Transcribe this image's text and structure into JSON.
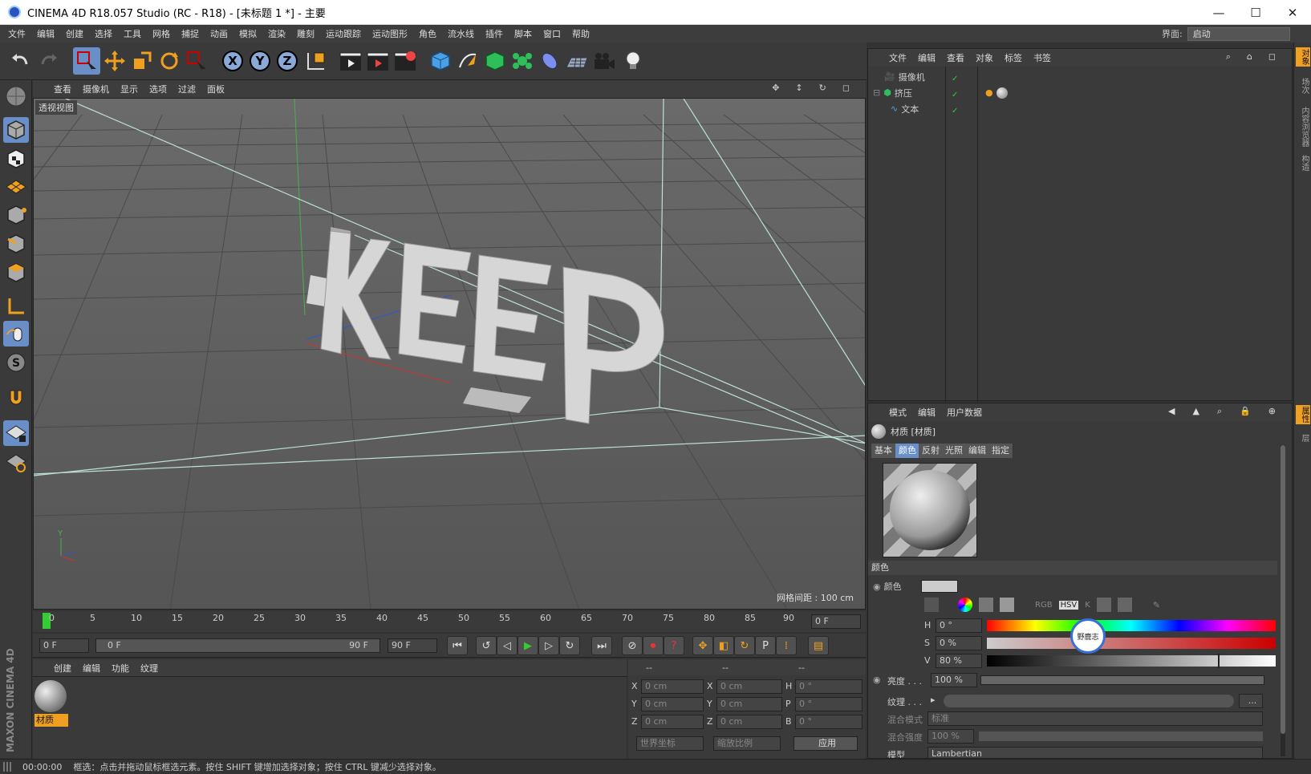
{
  "window": {
    "title": "CINEMA 4D R18.057 Studio (RC - R18) - [未标题 1 *] - 主要",
    "minimize": "—",
    "maximize": "☐",
    "close": "✕"
  },
  "menu": [
    "文件",
    "编辑",
    "创建",
    "选择",
    "工具",
    "网格",
    "捕捉",
    "动画",
    "模拟",
    "渲染",
    "雕刻",
    "运动跟踪",
    "运动图形",
    "角色",
    "流水线",
    "插件",
    "脚本",
    "窗口",
    "帮助"
  ],
  "layout": {
    "label": "界面:",
    "value": "启动"
  },
  "toolbar": {
    "axis_x": "X",
    "axis_y": "Y",
    "axis_z": "Z"
  },
  "viewport": {
    "menu": [
      "查看",
      "摄像机",
      "显示",
      "选项",
      "过滤",
      "面板"
    ],
    "label": "透视视图",
    "grid_info": "网格间距 : 100 cm",
    "text_object": "KEEP"
  },
  "timeline": {
    "ticks": [
      "0",
      "5",
      "10",
      "15",
      "20",
      "25",
      "30",
      "35",
      "40",
      "45",
      "50",
      "55",
      "60",
      "65",
      "70",
      "75",
      "80",
      "85",
      "90"
    ],
    "current_frame": "0 F",
    "start": "0 F",
    "range_start": "0 F",
    "range_end": "90 F",
    "end": "90 F"
  },
  "material_manager": {
    "menu": [
      "创建",
      "编辑",
      "功能",
      "纹理"
    ],
    "material_name": "材质"
  },
  "coordinates": {
    "headers": [
      "--",
      "--",
      "--"
    ],
    "rows": [
      {
        "a": "X",
        "av": "0 cm",
        "b": "X",
        "bv": "0 cm",
        "c": "H",
        "cv": "0 °"
      },
      {
        "a": "Y",
        "av": "0 cm",
        "b": "Y",
        "bv": "0 cm",
        "c": "P",
        "cv": "0 °"
      },
      {
        "a": "Z",
        "av": "0 cm",
        "b": "Z",
        "bv": "0 cm",
        "c": "B",
        "cv": "0 °"
      }
    ],
    "world": "世界坐标",
    "scale": "缩放比例",
    "apply": "应用"
  },
  "object_manager": {
    "menu": [
      "文件",
      "编辑",
      "查看",
      "对象",
      "标签",
      "书签"
    ],
    "objects": [
      {
        "name": "摄像机",
        "indent": 0
      },
      {
        "name": "挤压",
        "indent": 0
      },
      {
        "name": "文本",
        "indent": 1
      }
    ]
  },
  "attributes": {
    "menu": [
      "模式",
      "编辑",
      "用户数据"
    ],
    "title": "材质 [材质]",
    "tabs": [
      "基本",
      "颜色",
      "反射",
      "光照",
      "编辑",
      "指定"
    ],
    "selected_tab": "颜色",
    "section": "颜色",
    "color_label": "颜色",
    "h_label": "H",
    "h_value": "0 °",
    "s_label": "S",
    "s_value": "0 %",
    "v_label": "V",
    "v_value": "80 %",
    "brightness_label": "亮度 . . .",
    "brightness_value": "100 %",
    "texture_label": "纹理 . . .",
    "texture_more": "...",
    "blend_mode_label": "混合模式",
    "blend_mode_value": "标准",
    "blend_strength_label": "混合强度",
    "blend_strength_value": "100 %",
    "model_label": "模型",
    "model_value": "Lambertian",
    "color_mode_tabs": [
      "RGB",
      "HSV",
      "K"
    ],
    "watermark": "野鹿志"
  },
  "right_strip": [
    "对象",
    "场次",
    "内容浏览器",
    "构造",
    "属性",
    "层"
  ],
  "status": {
    "time": "00:00:00",
    "message": "框选：点击并拖动鼠标框选元素。按住 SHIFT 键增加选择对象；按住 CTRL 键减少选择对象。"
  },
  "brand": "MAXON CINEMA 4D"
}
